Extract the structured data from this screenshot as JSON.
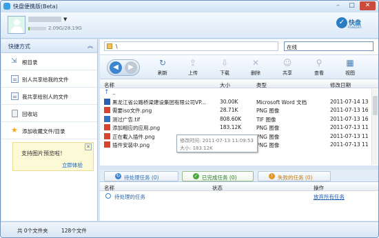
{
  "window": {
    "title": "快盘便携版(Beta)",
    "min_label": "–",
    "max_label": "□",
    "close_label": "✕"
  },
  "user": {
    "quota": "2.09G/28.19G",
    "quota_fraction": 0.074
  },
  "logo": {
    "name": "快盘",
    "sub": "kuaipan"
  },
  "sidebar": {
    "header": "快捷方式",
    "items": [
      {
        "label": "根目录",
        "icon": "root-folder-icon"
      },
      {
        "label": "别人共享给我的文件",
        "icon": "shared-with-me-icon"
      },
      {
        "label": "我共享给别人的文件",
        "icon": "my-shared-icon"
      },
      {
        "label": "回收站",
        "icon": "recycle-bin-icon"
      },
      {
        "label": "添加收藏文件/目录",
        "icon": "star-icon"
      }
    ]
  },
  "promo": {
    "text": "支持图片预览啦！",
    "action": "立即体验"
  },
  "path": {
    "text": "\\"
  },
  "search": {
    "value": "在线"
  },
  "toolbar": {
    "refresh": "刷新",
    "upload": "上传",
    "download": "下载",
    "delete": "删除",
    "share": "共享",
    "view_file": "查看",
    "view_mode": "视图"
  },
  "columns": {
    "name": "名称",
    "size": "大小",
    "type": "类型",
    "date": "修改日期"
  },
  "files": [
    {
      "name": "..",
      "size": "",
      "type": "",
      "date": ""
    },
    {
      "name": "黑龙江省公路桥梁建设集团有限公司VP...",
      "size": "30.00K",
      "type": "Microsoft Word 文档",
      "date": "2011-07-14 13"
    },
    {
      "name": "需要iso文件.png",
      "size": "28.71K",
      "type": "PNG 图像",
      "date": "2011-07-13 16"
    },
    {
      "name": "测过广告.tif",
      "size": "808.60K",
      "type": "TIF 图像",
      "date": "2011-07-13 16"
    },
    {
      "name": "添加相应的应用.png",
      "size": "183.12K",
      "type": "PNG 图像",
      "date": "2011-07-13 11"
    },
    {
      "name": "正在載入插件.png",
      "size": "",
      "type": "PNG 图像",
      "date": "2011-07-13 11"
    },
    {
      "name": "插件安装中.png",
      "size": "",
      "type": "PNG 图像",
      "date": "2011-07-13 11"
    }
  ],
  "tooltip": {
    "time": "修改时间: 2011-07-13 11:09:53",
    "size": "大小: 183.12K"
  },
  "tabs": {
    "pending": "待处理任务 (0)",
    "completed": "已完成任务 (0)",
    "failed": "失败的任务 (0)"
  },
  "task_columns": {
    "name": "名称",
    "status": "状态",
    "action": "操作"
  },
  "task_row": {
    "name": "待处理的任务",
    "action": "放弃所有任务"
  },
  "status_bar": {
    "folders": "共 0个文件夹",
    "files": "128个文件"
  },
  "colors": {
    "accent": "#3d85cf",
    "pending": "#2f6fb8",
    "done": "#2a7a2a",
    "failed": "#c07c10"
  }
}
